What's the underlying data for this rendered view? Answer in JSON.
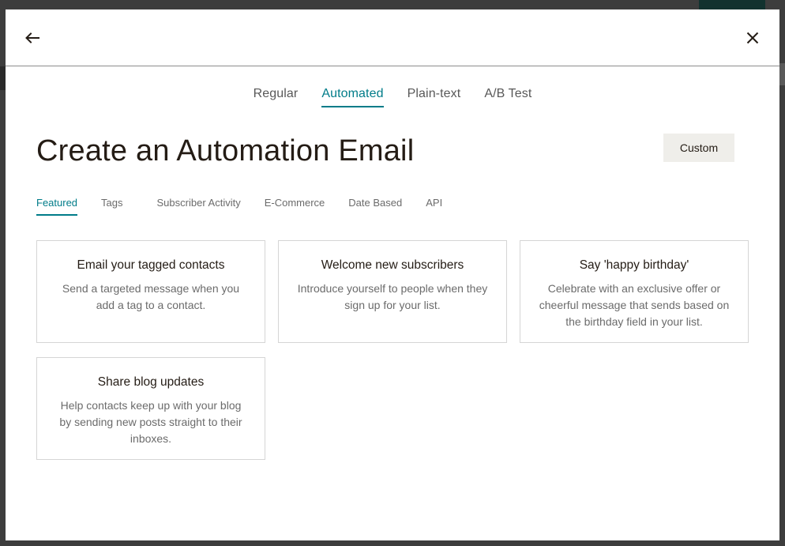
{
  "header": {
    "back_icon": "arrow-left-icon",
    "close_icon": "close-icon"
  },
  "type_tabs": [
    {
      "label": "Regular",
      "active": false
    },
    {
      "label": "Automated",
      "active": true
    },
    {
      "label": "Plain-text",
      "active": false
    },
    {
      "label": "A/B Test",
      "active": false
    }
  ],
  "title": "Create an Automation Email",
  "custom_button": "Custom",
  "category_tabs": [
    {
      "label": "Featured",
      "active": true
    },
    {
      "label": "Tags",
      "active": false
    },
    {
      "label": "Subscriber Activity",
      "active": false
    },
    {
      "label": "E-Commerce",
      "active": false
    },
    {
      "label": "Date Based",
      "active": false
    },
    {
      "label": "API",
      "active": false
    }
  ],
  "cards": [
    {
      "title": "Email your tagged contacts",
      "description": "Send a targeted message when you add a tag to a contact."
    },
    {
      "title": "Welcome new subscribers",
      "description": "Introduce yourself to people when they sign up for your list."
    },
    {
      "title": "Say 'happy birthday'",
      "description": "Celebrate with an exclusive offer or cheerful message that sends based on the birthday field in your list."
    },
    {
      "title": "Share blog updates",
      "description": "Help contacts keep up with your blog by sending new posts straight to their inboxes."
    }
  ],
  "colors": {
    "accent": "#007c89",
    "title_text": "#241c15",
    "secondary_text": "#6b6b6b",
    "custom_button_bg": "#efeeea"
  }
}
